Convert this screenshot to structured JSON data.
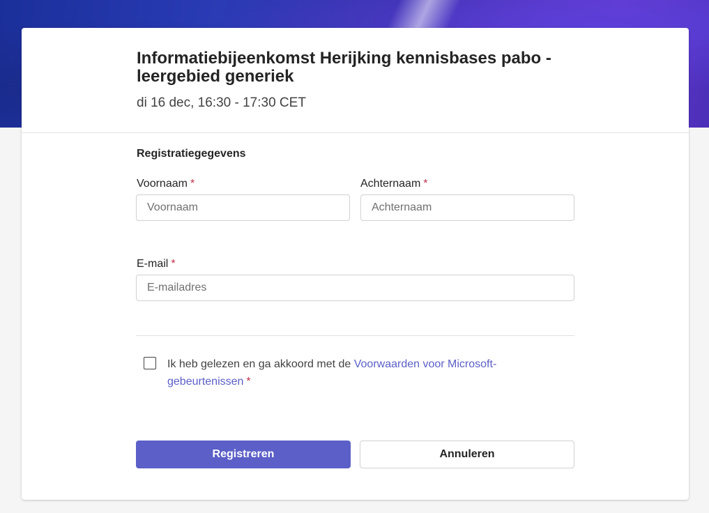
{
  "event": {
    "title": "Informatiebijeenkomst Herijking kennisbases pabo - leergebied generiek",
    "time": "di 16 dec, 16:30 - 17:30 CET"
  },
  "form": {
    "section_title": "Registratiegegevens",
    "required_marker": "*",
    "first_name": {
      "label": "Voornaam",
      "placeholder": "Voornaam",
      "value": ""
    },
    "last_name": {
      "label": "Achternaam",
      "placeholder": "Achternaam",
      "value": ""
    },
    "email": {
      "label": "E-mail",
      "placeholder": "E-mailadres",
      "value": ""
    },
    "consent": {
      "checked": false,
      "text": "Ik heb gelezen en ga akkoord met de ",
      "link_text": "Voorwaarden voor Microsoft-gebeurtenissen"
    }
  },
  "actions": {
    "register_label": "Registreren",
    "cancel_label": "Annuleren"
  },
  "colors": {
    "accent": "#5b5fc7",
    "required": "#c4314b"
  }
}
